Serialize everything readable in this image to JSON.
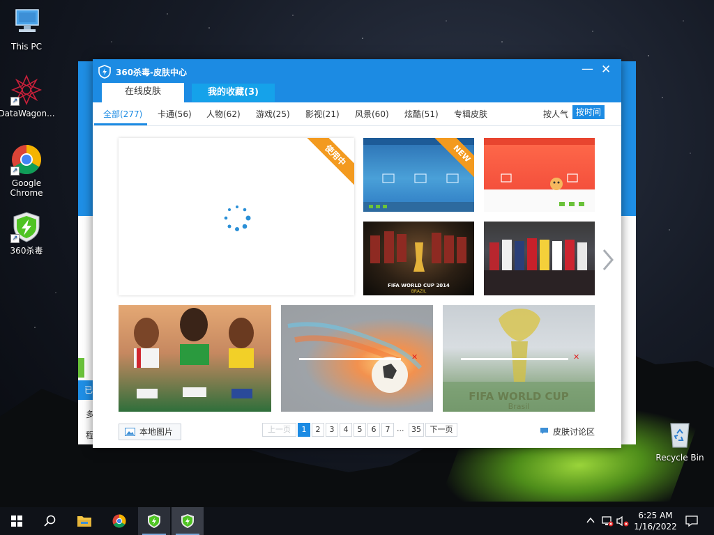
{
  "desktop": {
    "icons": {
      "this_pc": "This PC",
      "datawagon": "DataWagon...",
      "chrome": "Google Chrome",
      "av360": "360杀毒",
      "recycle": "Recycle Bin"
    }
  },
  "background_window": {
    "fragments": [
      "已",
      "多",
      "程"
    ]
  },
  "skin_window": {
    "title": "360杀毒-皮肤中心",
    "tabs": {
      "online": "在线皮肤",
      "favorites": "我的收藏(3)"
    },
    "categories": [
      "全部(277)",
      "卡通(56)",
      "人物(62)",
      "游戏(25)",
      "影视(21)",
      "风景(60)",
      "炫酷(51)",
      "专辑皮肤"
    ],
    "sort": {
      "popularity": "按人气",
      "time": "按时间"
    },
    "ribbons": {
      "in_use": "使用中",
      "new": "NEW"
    },
    "thumb_texts": {
      "worldcup_caption": "FIFA WORLD CUP 2014",
      "worldcup_sub": "BRAZIL",
      "trophy_caption": "FIFA WORLD CUP",
      "trophy_sub": "Brasil"
    },
    "local_image_button": "本地图片",
    "pagination": {
      "prev": "上一页",
      "pages": [
        "1",
        "2",
        "3",
        "4",
        "5",
        "6",
        "7"
      ],
      "ellipsis": "...",
      "last": "35",
      "next": "下一页",
      "current": "1"
    },
    "discussion_link": "皮肤讨论区"
  },
  "taskbar": {
    "time": "6:25 AM",
    "date": "1/16/2022"
  },
  "colors": {
    "accent": "#1c8be3",
    "tab_fav": "#15a2ea",
    "ribbon": "#f39a1f"
  }
}
